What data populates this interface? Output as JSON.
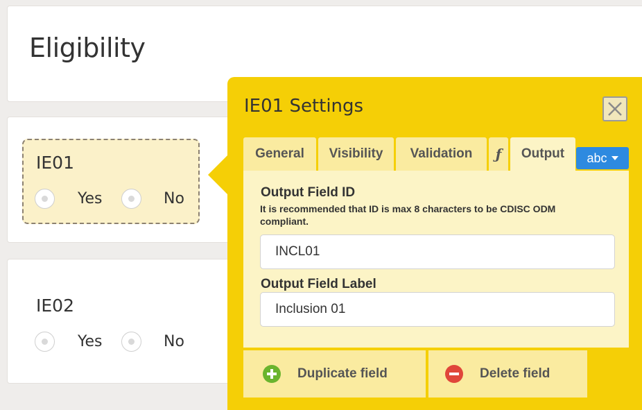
{
  "section": {
    "title": "Eligibility"
  },
  "fields": [
    {
      "id": "IE01",
      "options": [
        "Yes",
        "No"
      ]
    },
    {
      "id": "IE02",
      "options": [
        "Yes",
        "No"
      ]
    }
  ],
  "popover": {
    "title": "IE01 Settings",
    "close_icon": "close-icon",
    "tabs": [
      "General",
      "Visibility",
      "Validation",
      "ƒ",
      "Output"
    ],
    "active_tab": "Output",
    "type_dropdown": "abc",
    "output": {
      "id_label": "Output Field ID",
      "id_hint": "It is recommended that ID is max 8 characters to be CDISC ODM compliant.",
      "id_value": "INCL01",
      "label_label": "Output Field Label",
      "label_value": "Inclusion 01"
    },
    "actions": {
      "duplicate": "Duplicate field",
      "delete": "Delete field"
    }
  },
  "colors": {
    "popover": "#f5cf06",
    "accent": "#2d8ae0",
    "add": "#6ab42d",
    "delete": "#e0463a"
  }
}
